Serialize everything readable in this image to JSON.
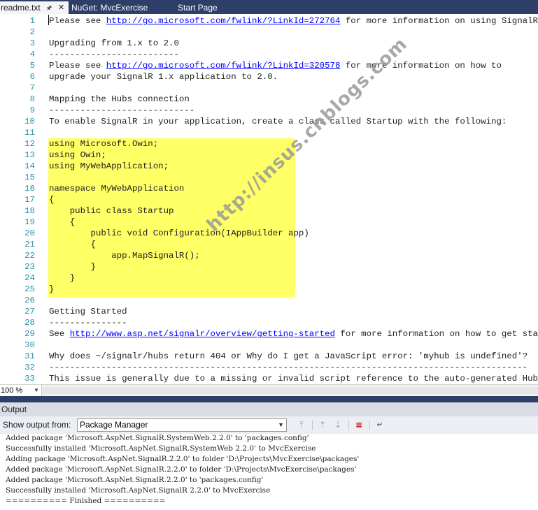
{
  "tabs": [
    {
      "label": "readme.txt",
      "active": true
    },
    {
      "label": "NuGet: MvcExercise",
      "active": false
    },
    {
      "label": "Start Page",
      "active": false
    }
  ],
  "editor": {
    "highlight_color": "#ffff66",
    "lines": [
      {
        "n": "1",
        "parts": [
          {
            "t": "Please see "
          },
          {
            "t": "http://go.microsoft.com/fwlink/?LinkId=272764",
            "link": true
          },
          {
            "t": " for more information on using SignalR."
          }
        ]
      },
      {
        "n": "2",
        "parts": []
      },
      {
        "n": "3",
        "parts": [
          {
            "t": "Upgrading from 1.x to 2.0"
          }
        ]
      },
      {
        "n": "4",
        "parts": [
          {
            "t": "-------------------------"
          }
        ]
      },
      {
        "n": "5",
        "parts": [
          {
            "t": "Please see "
          },
          {
            "t": "http://go.microsoft.com/fwlink/?LinkId=320578",
            "link": true
          },
          {
            "t": " for more information on how to"
          }
        ]
      },
      {
        "n": "6",
        "parts": [
          {
            "t": "upgrade your SignalR 1.x application to 2.0."
          }
        ]
      },
      {
        "n": "7",
        "parts": []
      },
      {
        "n": "8",
        "parts": [
          {
            "t": "Mapping the Hubs connection"
          }
        ]
      },
      {
        "n": "9",
        "parts": [
          {
            "t": "----------------------------"
          }
        ]
      },
      {
        "n": "10",
        "parts": [
          {
            "t": "To enable SignalR in your application, create a class called Startup with the following:"
          }
        ]
      },
      {
        "n": "11",
        "parts": []
      },
      {
        "n": "12",
        "parts": [
          {
            "t": "using Microsoft.Owin;"
          }
        ]
      },
      {
        "n": "13",
        "parts": [
          {
            "t": "using Owin;"
          }
        ]
      },
      {
        "n": "14",
        "parts": [
          {
            "t": "using MyWebApplication;"
          }
        ]
      },
      {
        "n": "15",
        "parts": []
      },
      {
        "n": "16",
        "parts": [
          {
            "t": "namespace MyWebApplication"
          }
        ]
      },
      {
        "n": "17",
        "parts": [
          {
            "t": "{"
          }
        ]
      },
      {
        "n": "18",
        "parts": [
          {
            "t": "    public class Startup"
          }
        ]
      },
      {
        "n": "19",
        "parts": [
          {
            "t": "    {"
          }
        ]
      },
      {
        "n": "20",
        "parts": [
          {
            "t": "        public void Configuration(IAppBuilder app)"
          }
        ]
      },
      {
        "n": "21",
        "parts": [
          {
            "t": "        {"
          }
        ]
      },
      {
        "n": "22",
        "parts": [
          {
            "t": "            app.MapSignalR();"
          }
        ]
      },
      {
        "n": "23",
        "parts": [
          {
            "t": "        }"
          }
        ]
      },
      {
        "n": "24",
        "parts": [
          {
            "t": "    }"
          }
        ]
      },
      {
        "n": "25",
        "parts": [
          {
            "t": "}"
          }
        ]
      },
      {
        "n": "26",
        "parts": []
      },
      {
        "n": "27",
        "parts": [
          {
            "t": "Getting Started"
          }
        ]
      },
      {
        "n": "28",
        "parts": [
          {
            "t": "---------------"
          }
        ]
      },
      {
        "n": "29",
        "parts": [
          {
            "t": "See "
          },
          {
            "t": "http://www.asp.net/signalr/overview/getting-started",
            "link": true
          },
          {
            "t": " for more information on how to get started."
          }
        ]
      },
      {
        "n": "30",
        "parts": []
      },
      {
        "n": "31",
        "parts": [
          {
            "t": "Why does ~/signalr/hubs return 404 or Why do I get a JavaScript error: 'myhub is undefined'?"
          }
        ]
      },
      {
        "n": "32",
        "parts": [
          {
            "t": "--------------------------------------------------------------------------------------------"
          }
        ]
      },
      {
        "n": "33",
        "parts": [
          {
            "t": "This issue is generally due to a missing or invalid script reference to the auto-generated Hub JavaScript"
          }
        ]
      }
    ]
  },
  "zoom": {
    "value": "100 %"
  },
  "output": {
    "title": "Output",
    "show_label": "Show output from:",
    "source": "Package Manager",
    "lines": [
      "Added package 'Microsoft.AspNet.SignalR.SystemWeb.2.2.0' to 'packages.config'",
      "Successfully installed 'Microsoft.AspNet.SignalR.SystemWeb 2.2.0' to MvcExercise",
      "Adding package 'Microsoft.AspNet.SignalR.2.2.0' to folder 'D:\\Projects\\MvcExercise\\packages'",
      "Added package 'Microsoft.AspNet.SignalR.2.2.0' to folder 'D:\\Projects\\MvcExercise\\packages'",
      "Added package 'Microsoft.AspNet.SignalR.2.2.0' to 'packages.config'",
      "Successfully installed 'Microsoft.AspNet.SignalR 2.2.0' to MvcExercise",
      "========== Finished =========="
    ],
    "toolbar_icons": [
      "find-message-icon",
      "go-previous-icon",
      "go-next-icon",
      "clear-all-icon",
      "toggle-word-wrap-icon"
    ]
  },
  "watermark": "http://insus.cnblogs.com"
}
